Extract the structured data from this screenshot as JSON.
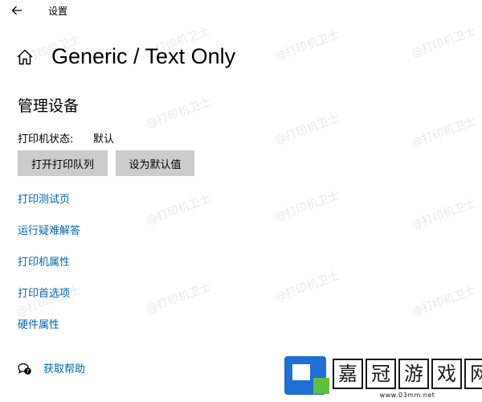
{
  "app": {
    "title": "设置",
    "back_icon": "arrow-left-icon"
  },
  "header": {
    "home_icon": "home-icon",
    "printer_name": "Generic / Text Only"
  },
  "manage": {
    "section_title": "管理设备",
    "status_label": "打印机状态:",
    "status_value": "默认",
    "open_queue_label": "打开打印队列",
    "set_default_label": "设为默认值"
  },
  "links": [
    "打印测试页",
    "运行疑难解答",
    "打印机属性",
    "打印首选项",
    "硬件属性"
  ],
  "help": {
    "icon": "chat-help-icon",
    "label": "获取帮助"
  },
  "watermark": {
    "text": "@打印机卫士"
  },
  "site_logo": {
    "chars": [
      "嘉",
      "冠",
      "游",
      "戏",
      "网"
    ],
    "url": "www.03mm.net"
  },
  "colors": {
    "link": "#0066b4",
    "button_bg": "#cccccc",
    "background": "#ffffff",
    "logo_blue": "#1f6fd6",
    "logo_green": "#5fc13a"
  }
}
